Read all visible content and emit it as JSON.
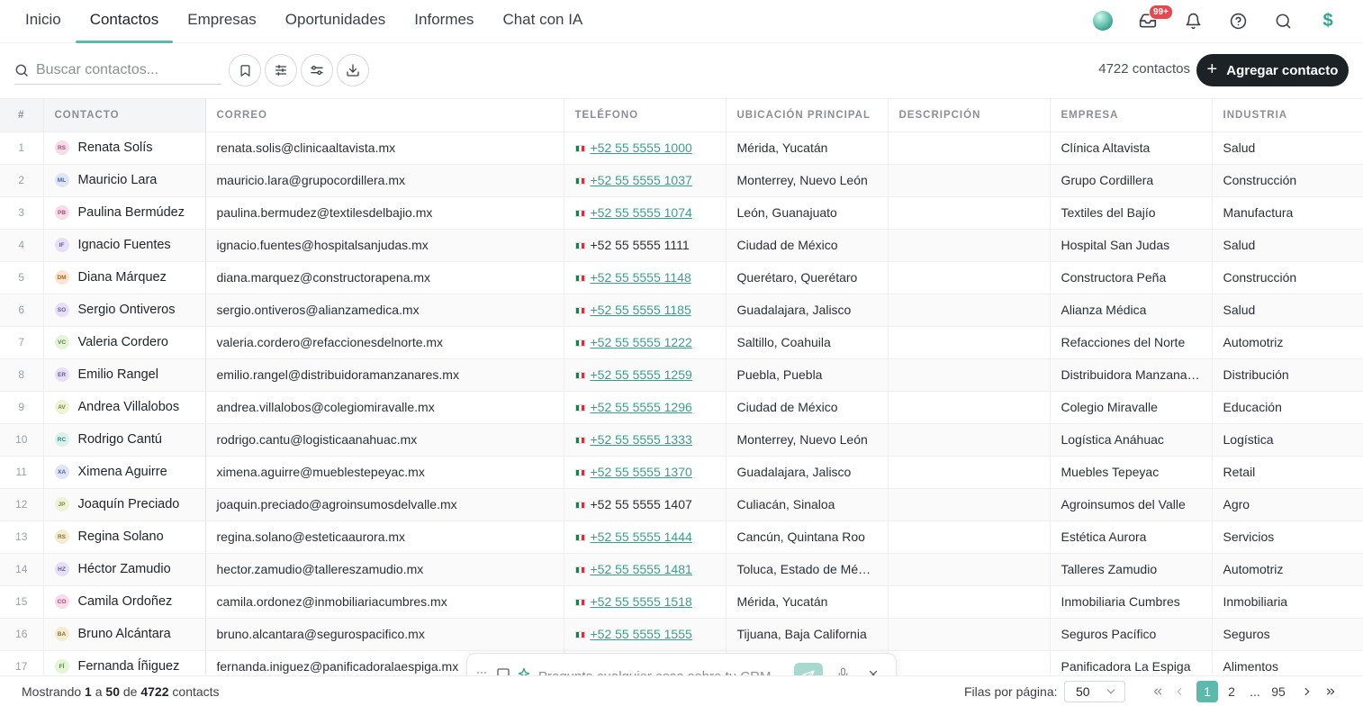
{
  "nav": {
    "tabs": [
      "Inicio",
      "Contactos",
      "Empresas",
      "Oportunidades",
      "Informes",
      "Chat con IA"
    ],
    "active_tab": "Contactos",
    "inbox_badge": "99+",
    "credits_icon": "$"
  },
  "toolbar": {
    "search_placeholder": "Buscar contactos...",
    "contact_count": "4722 contactos",
    "add_label": "Agregar contacto"
  },
  "table": {
    "headers": {
      "num": "#",
      "contact": "CONTACTO",
      "email": "CORREO",
      "phone": "TELÉFONO",
      "location": "UBICACIÓN PRINCIPAL",
      "description": "DESCRIPCIÓN",
      "company": "EMPRESA",
      "industry": "INDUSTRIA"
    },
    "rows": [
      {
        "num": "1",
        "initials": "RS",
        "name": "Renata Solís",
        "email": "renata.solis@clinicaaltavista.mx",
        "phone": "+52 55 5555 1000",
        "phone_link": true,
        "location": "Mérida, Yucatán",
        "description": "",
        "company": "Clínica Altavista",
        "industry": "Salud",
        "av_bg": "#f6dbe9",
        "av_fg": "#b0457c"
      },
      {
        "num": "2",
        "initials": "ML",
        "name": "Mauricio Lara",
        "email": "mauricio.lara@grupocordillera.mx",
        "phone": "+52 55 5555 1037",
        "phone_link": true,
        "location": "Monterrey, Nuevo León",
        "description": "",
        "company": "Grupo Cordillera",
        "industry": "Construcción",
        "av_bg": "#dfe5f5",
        "av_fg": "#4a5fa0"
      },
      {
        "num": "3",
        "initials": "PB",
        "name": "Paulina Bermúdez",
        "email": "paulina.bermudez@textilesdelbajio.mx",
        "phone": "+52 55 5555 1074",
        "phone_link": true,
        "location": "León, Guanajuato",
        "description": "",
        "company": "Textiles del Bajío",
        "industry": "Manufactura",
        "av_bg": "#f6dbe9",
        "av_fg": "#b0457c"
      },
      {
        "num": "4",
        "initials": "IF",
        "name": "Ignacio Fuentes",
        "email": "ignacio.fuentes@hospitalsanjudas.mx",
        "phone": "+52 55 5555 1111",
        "phone_link": false,
        "location": "Ciudad de México",
        "description": "",
        "company": "Hospital San Judas",
        "industry": "Salud",
        "av_bg": "#e6e0f5",
        "av_fg": "#6a55a8"
      },
      {
        "num": "5",
        "initials": "DM",
        "name": "Diana Márquez",
        "email": "diana.marquez@constructorapena.mx",
        "phone": "+52 55 5555 1148",
        "phone_link": true,
        "location": "Querétaro, Querétaro",
        "description": "",
        "company": "Constructora Peña",
        "industry": "Construcción",
        "av_bg": "#f8e5d2",
        "av_fg": "#a8652a"
      },
      {
        "num": "6",
        "initials": "SO",
        "name": "Sergio Ontiveros",
        "email": "sergio.ontiveros@alianzamedica.mx",
        "phone": "+52 55 5555 1185",
        "phone_link": true,
        "location": "Guadalajara, Jalisco",
        "description": "",
        "company": "Alianza Médica",
        "industry": "Salud",
        "av_bg": "#e6e0f5",
        "av_fg": "#6a55a8"
      },
      {
        "num": "7",
        "initials": "VC",
        "name": "Valeria Cordero",
        "email": "valeria.cordero@refaccionesdelnorte.mx",
        "phone": "+52 55 5555 1222",
        "phone_link": true,
        "location": "Saltillo, Coahuila",
        "description": "",
        "company": "Refacciones del Norte",
        "industry": "Automotriz",
        "av_bg": "#e4f3d9",
        "av_fg": "#4f8a2c"
      },
      {
        "num": "8",
        "initials": "ER",
        "name": "Emilio Rangel",
        "email": "emilio.rangel@distribuidoramanzanares.mx",
        "phone": "+52 55 5555 1259",
        "phone_link": true,
        "location": "Puebla, Puebla",
        "description": "",
        "company": "Distribuidora Manzanares",
        "industry": "Distribución",
        "av_bg": "#e6e0f5",
        "av_fg": "#6a55a8"
      },
      {
        "num": "9",
        "initials": "AV",
        "name": "Andrea Villalobos",
        "email": "andrea.villalobos@colegiomiravalle.mx",
        "phone": "+52 55 5555 1296",
        "phone_link": true,
        "location": "Ciudad de México",
        "description": "",
        "company": "Colegio Miravalle",
        "industry": "Educación",
        "av_bg": "#eef2d6",
        "av_fg": "#7a8a2a"
      },
      {
        "num": "10",
        "initials": "RC",
        "name": "Rodrigo Cantú",
        "email": "rodrigo.cantu@logisticaanahuac.mx",
        "phone": "+52 55 5555 1333",
        "phone_link": true,
        "location": "Monterrey, Nuevo León",
        "description": "",
        "company": "Logística Anáhuac",
        "industry": "Logística",
        "av_bg": "#dcf1ec",
        "av_fg": "#2f8a78"
      },
      {
        "num": "11",
        "initials": "XA",
        "name": "Ximena Aguirre",
        "email": "ximena.aguirre@mueblestepeyac.mx",
        "phone": "+52 55 5555 1370",
        "phone_link": true,
        "location": "Guadalajara, Jalisco",
        "description": "",
        "company": "Muebles Tepeyac",
        "industry": "Retail",
        "av_bg": "#dfe5f5",
        "av_fg": "#4a5fa0"
      },
      {
        "num": "12",
        "initials": "JP",
        "name": "Joaquín Preciado",
        "email": "joaquin.preciado@agroinsumosdelvalle.mx",
        "phone": "+52 55 5555 1407",
        "phone_link": false,
        "location": "Culiacán, Sinaloa",
        "description": "",
        "company": "Agroinsumos del Valle",
        "industry": "Agro",
        "av_bg": "#eef2d6",
        "av_fg": "#7a8a2a"
      },
      {
        "num": "13",
        "initials": "RS",
        "name": "Regina Solano",
        "email": "regina.solano@esteticaaurora.mx",
        "phone": "+52 55 5555 1444",
        "phone_link": true,
        "location": "Cancún, Quintana Roo",
        "description": "",
        "company": "Estética Aurora",
        "industry": "Servicios",
        "av_bg": "#f3ecd2",
        "av_fg": "#8a7428"
      },
      {
        "num": "14",
        "initials": "HZ",
        "name": "Héctor Zamudio",
        "email": "hector.zamudio@tallereszamudio.mx",
        "phone": "+52 55 5555 1481",
        "phone_link": true,
        "location": "Toluca, Estado de México",
        "description": "",
        "company": "Talleres Zamudio",
        "industry": "Automotriz",
        "av_bg": "#e6e0f5",
        "av_fg": "#6a55a8"
      },
      {
        "num": "15",
        "initials": "CO",
        "name": "Camila Ordoñez",
        "email": "camila.ordonez@inmobiliariacumbres.mx",
        "phone": "+52 55 5555 1518",
        "phone_link": true,
        "location": "Mérida, Yucatán",
        "description": "",
        "company": "Inmobiliaria Cumbres",
        "industry": "Inmobiliaria",
        "av_bg": "#f6dbe9",
        "av_fg": "#b0457c"
      },
      {
        "num": "16",
        "initials": "BA",
        "name": "Bruno Alcántara",
        "email": "bruno.alcantara@segurospacifico.mx",
        "phone": "+52 55 5555 1555",
        "phone_link": true,
        "location": "Tijuana, Baja California",
        "description": "",
        "company": "Seguros Pacífico",
        "industry": "Seguros",
        "av_bg": "#f3ecd2",
        "av_fg": "#8a7428"
      },
      {
        "num": "17",
        "initials": "FÍ",
        "name": "Fernanda Íñiguez",
        "email": "fernanda.iniguez@panificadoralaespiga.mx",
        "phone": "",
        "phone_link": false,
        "location": "",
        "description": "",
        "company": "Panificadora La Espiga",
        "industry": "Alimentos",
        "av_bg": "#e4f3d9",
        "av_fg": "#4f8a2c"
      }
    ]
  },
  "footer": {
    "showing_prefix": "Mostrando",
    "from": "1",
    "to_word": "a",
    "to": "50",
    "of_word": "de",
    "total": "4722",
    "suffix": "contacts",
    "rows_per_page_label": "Filas por página:",
    "rows_per_page": "50",
    "pages": [
      "1",
      "2",
      "...",
      "95"
    ],
    "current_page": "1"
  },
  "chat": {
    "placeholder": "Pregunta cualquier cosa sobre tu CRM..."
  },
  "colors": {
    "accent": "#5fb8ac",
    "link": "#3a9e8c",
    "primary_button": "#1d2227",
    "badge": "#e5484d"
  }
}
